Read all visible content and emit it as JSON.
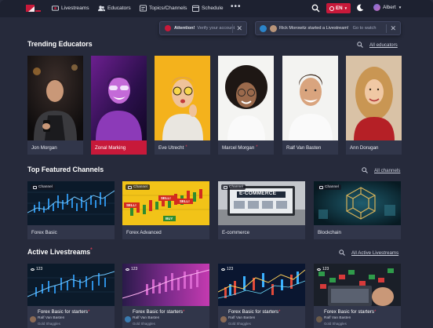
{
  "colors": {
    "accent": "#c7193a",
    "background": "#262a3b",
    "card": "#31364a",
    "nav": "#1d2130"
  },
  "nav": {
    "items": [
      {
        "label": "Livestreams",
        "icon": "livestream-icon"
      },
      {
        "label": "Educators",
        "icon": "people-icon"
      },
      {
        "label": "Topics/Channels",
        "icon": "topics-icon"
      },
      {
        "label": "Schedule",
        "icon": "calendar-icon"
      }
    ],
    "more": "•••",
    "language": "EN",
    "user_name": "Albert"
  },
  "toasts": [
    {
      "title": "Attention!",
      "text": "Verify your account"
    },
    {
      "title": "Rick Morowitz started a Livestream!",
      "text": "Go to watch"
    }
  ],
  "educators": {
    "title": "Trending Educators",
    "see_all": "All educators",
    "items": [
      {
        "name": "Jon Morgan",
        "starred": false,
        "active": false
      },
      {
        "name": "Zonal Marking",
        "starred": false,
        "active": true
      },
      {
        "name": "Eve Utrecht",
        "starred": true,
        "active": false
      },
      {
        "name": "Marcel Morgan",
        "starred": true,
        "active": false
      },
      {
        "name": "Ralf Van Basten",
        "starred": false,
        "active": false
      },
      {
        "name": "Ann Dorugan",
        "starred": false,
        "active": false
      }
    ]
  },
  "channels": {
    "title": "Top Featured Channels",
    "see_all": "All channels",
    "tag_label": "Channel",
    "items": [
      {
        "name": "Forex Basic"
      },
      {
        "name": "Forex Advanced"
      },
      {
        "name": "E-commerce",
        "overlay": "E-COMMERCE"
      },
      {
        "name": "Blockchain"
      }
    ],
    "forex_advanced_labels": [
      "SELL!",
      "SELL!",
      "SELL!",
      "BUY"
    ]
  },
  "livestreams": {
    "title": "Active Livestreams",
    "see_all": "All Active Livestreams",
    "items": [
      {
        "viewers": "123",
        "title": "Forex Basic for starters",
        "author": "Ralf Van Basten",
        "channel": "Gold Shaggles"
      },
      {
        "viewers": "123",
        "title": "Forex Basic for starters",
        "author": "Ralf Van Basten",
        "channel": "Gold Shaggles"
      },
      {
        "viewers": "123",
        "title": "Forex Basic for starters",
        "author": "Ralf Van Basten",
        "channel": "Gold Shaggles"
      },
      {
        "viewers": "123",
        "title": "Forex Basic for starters",
        "author": "Ralf Van Basten",
        "channel": "Gold Shaggles"
      }
    ]
  }
}
